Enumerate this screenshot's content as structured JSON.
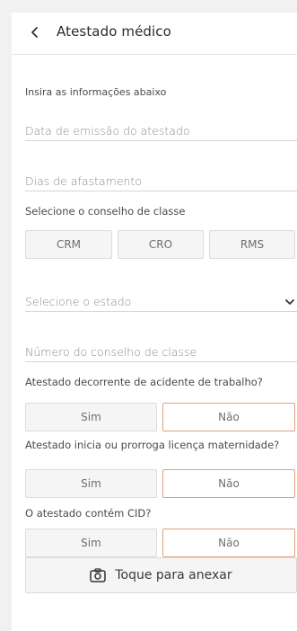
{
  "header": {
    "title": "Atestado médico",
    "back_icon": "chevron-left-icon"
  },
  "form": {
    "intro": "Insira as informações abaixo",
    "issue_date_placeholder": "Data de emissão do atestado",
    "days_off_placeholder": "Dias de afastamento",
    "council_label": "Selecione o conselho de classe",
    "council_options": [
      "CRM",
      "CRO",
      "RMS"
    ],
    "state_placeholder": "Selecione o estado",
    "state_icon": "chevron-down-icon",
    "council_number_placeholder": "Número do conselho de classe",
    "work_accident": {
      "question": "Atestado decorrente de acidente de trabalho?",
      "yes": "Sim",
      "no": "Não",
      "selected": "no"
    },
    "maternity": {
      "question": "Atestado inicia ou prorroga licença maternidade?",
      "yes": "Sim",
      "no": "Não",
      "selected": "no"
    },
    "cid": {
      "question": "O atestado contém CID?",
      "yes": "Sim",
      "no": "Não",
      "selected": "no"
    },
    "attach_label": "Toque para anexar",
    "attach_icon": "camera-icon"
  },
  "colors": {
    "selected_border": "#e0a07c",
    "button_bg": "#f5f5f5"
  }
}
